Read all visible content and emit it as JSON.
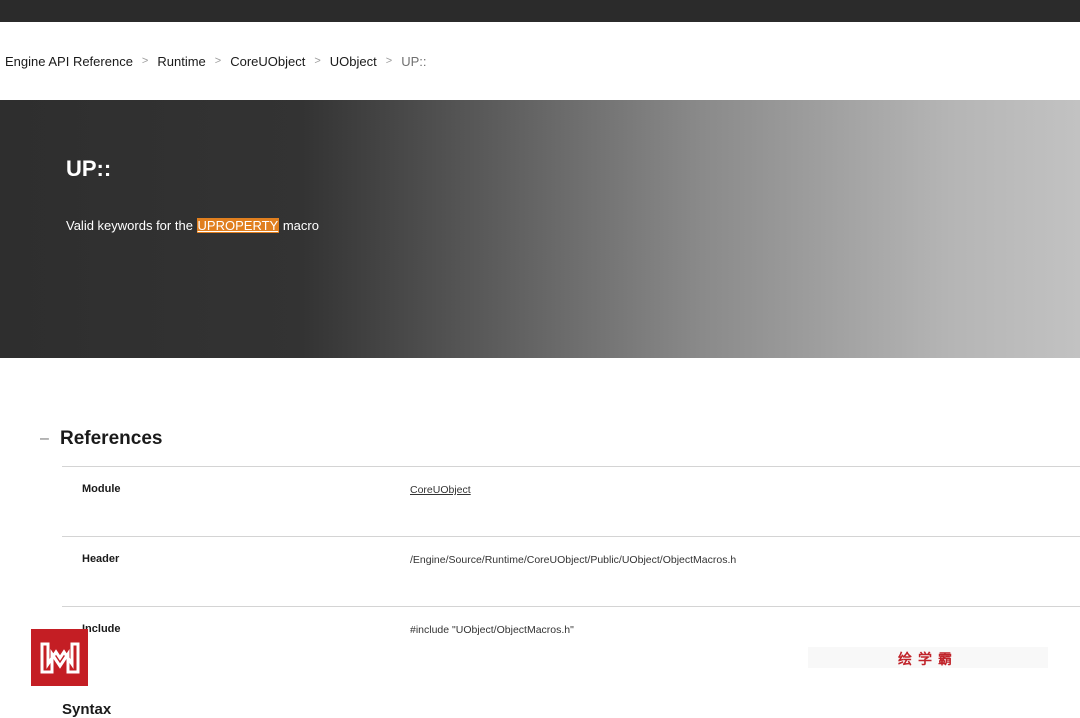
{
  "breadcrumb": {
    "items": [
      "Engine API Reference",
      "Runtime",
      "CoreUObject",
      "UObject"
    ],
    "separator": ">",
    "current": "UP::"
  },
  "hero": {
    "title": "UP::",
    "desc_prefix": "Valid keywords for the ",
    "desc_highlight": "UPROPERTY",
    "desc_suffix": " macro",
    "highlight_color": "#e07f1f"
  },
  "references": {
    "toggle": "–",
    "title": "References",
    "rows": [
      {
        "key": "Module",
        "value": "CoreUObject",
        "is_link": true
      },
      {
        "key": "Header",
        "value": "/Engine/Source/Runtime/CoreUObject/Public/UObject/ObjectMacros.h",
        "is_link": false
      },
      {
        "key": "Include",
        "value": "#include \"UObject/ObjectMacros.h\"",
        "is_link": false
      }
    ]
  },
  "next_section": {
    "title": "Syntax"
  },
  "watermark": {
    "text": "绘学霸",
    "color": "#c0232a"
  },
  "logo": {
    "icon": "logo-w-icon",
    "color": "#c41e24"
  }
}
